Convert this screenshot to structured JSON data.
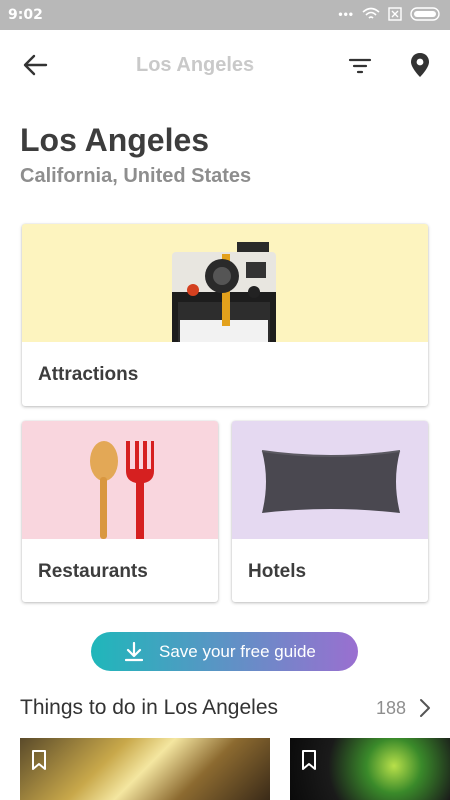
{
  "status_bar": {
    "time": "9:02",
    "icons": [
      "more-dots-icon",
      "wifi-icon",
      "sim-icon",
      "battery-icon"
    ]
  },
  "app_bar": {
    "title": "Los Angeles",
    "icons": [
      "back-arrow-icon",
      "filter-icon",
      "location-pin-icon"
    ]
  },
  "destination": {
    "city": "Los Angeles",
    "region": "California, United States"
  },
  "categories": [
    {
      "label": "Attractions",
      "image": "polaroid-camera"
    },
    {
      "label": "Restaurants",
      "image": "spoon-and-fork"
    },
    {
      "label": "Hotels",
      "image": "pillow"
    }
  ],
  "save_guide": {
    "label": "Save your free guide",
    "icon": "download-icon",
    "gradient": [
      "#1fb7ba",
      "#9a6fd0"
    ]
  },
  "things_to_do": {
    "title": "Things to do in Los Angeles",
    "count": "188",
    "icon": "chevron-right-icon"
  },
  "colors": {
    "attractions_bg": "#fdf4bf",
    "restaurants_bg": "#f9d6de",
    "hotels_bg": "#e5d9f1"
  }
}
